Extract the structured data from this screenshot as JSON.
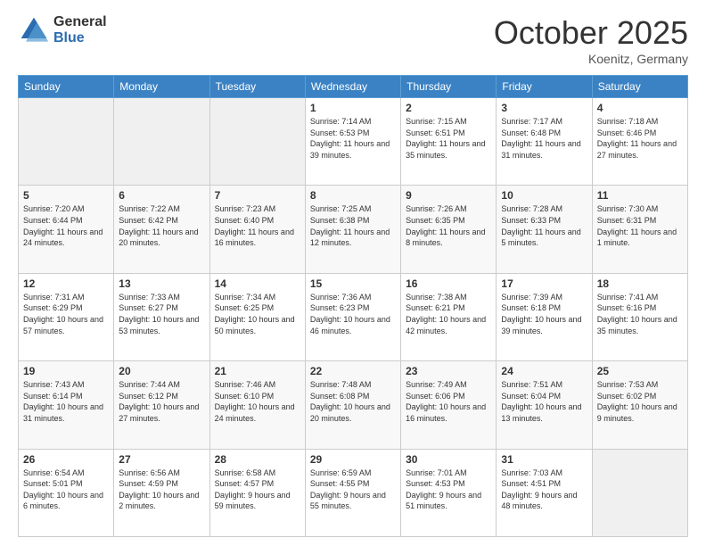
{
  "header": {
    "logo_general": "General",
    "logo_blue": "Blue",
    "month_title": "October 2025",
    "subtitle": "Koenitz, Germany"
  },
  "days_of_week": [
    "Sunday",
    "Monday",
    "Tuesday",
    "Wednesday",
    "Thursday",
    "Friday",
    "Saturday"
  ],
  "weeks": [
    [
      {
        "day": "",
        "info": ""
      },
      {
        "day": "",
        "info": ""
      },
      {
        "day": "",
        "info": ""
      },
      {
        "day": "1",
        "info": "Sunrise: 7:14 AM\nSunset: 6:53 PM\nDaylight: 11 hours and 39 minutes."
      },
      {
        "day": "2",
        "info": "Sunrise: 7:15 AM\nSunset: 6:51 PM\nDaylight: 11 hours and 35 minutes."
      },
      {
        "day": "3",
        "info": "Sunrise: 7:17 AM\nSunset: 6:48 PM\nDaylight: 11 hours and 31 minutes."
      },
      {
        "day": "4",
        "info": "Sunrise: 7:18 AM\nSunset: 6:46 PM\nDaylight: 11 hours and 27 minutes."
      }
    ],
    [
      {
        "day": "5",
        "info": "Sunrise: 7:20 AM\nSunset: 6:44 PM\nDaylight: 11 hours and 24 minutes."
      },
      {
        "day": "6",
        "info": "Sunrise: 7:22 AM\nSunset: 6:42 PM\nDaylight: 11 hours and 20 minutes."
      },
      {
        "day": "7",
        "info": "Sunrise: 7:23 AM\nSunset: 6:40 PM\nDaylight: 11 hours and 16 minutes."
      },
      {
        "day": "8",
        "info": "Sunrise: 7:25 AM\nSunset: 6:38 PM\nDaylight: 11 hours and 12 minutes."
      },
      {
        "day": "9",
        "info": "Sunrise: 7:26 AM\nSunset: 6:35 PM\nDaylight: 11 hours and 8 minutes."
      },
      {
        "day": "10",
        "info": "Sunrise: 7:28 AM\nSunset: 6:33 PM\nDaylight: 11 hours and 5 minutes."
      },
      {
        "day": "11",
        "info": "Sunrise: 7:30 AM\nSunset: 6:31 PM\nDaylight: 11 hours and 1 minute."
      }
    ],
    [
      {
        "day": "12",
        "info": "Sunrise: 7:31 AM\nSunset: 6:29 PM\nDaylight: 10 hours and 57 minutes."
      },
      {
        "day": "13",
        "info": "Sunrise: 7:33 AM\nSunset: 6:27 PM\nDaylight: 10 hours and 53 minutes."
      },
      {
        "day": "14",
        "info": "Sunrise: 7:34 AM\nSunset: 6:25 PM\nDaylight: 10 hours and 50 minutes."
      },
      {
        "day": "15",
        "info": "Sunrise: 7:36 AM\nSunset: 6:23 PM\nDaylight: 10 hours and 46 minutes."
      },
      {
        "day": "16",
        "info": "Sunrise: 7:38 AM\nSunset: 6:21 PM\nDaylight: 10 hours and 42 minutes."
      },
      {
        "day": "17",
        "info": "Sunrise: 7:39 AM\nSunset: 6:18 PM\nDaylight: 10 hours and 39 minutes."
      },
      {
        "day": "18",
        "info": "Sunrise: 7:41 AM\nSunset: 6:16 PM\nDaylight: 10 hours and 35 minutes."
      }
    ],
    [
      {
        "day": "19",
        "info": "Sunrise: 7:43 AM\nSunset: 6:14 PM\nDaylight: 10 hours and 31 minutes."
      },
      {
        "day": "20",
        "info": "Sunrise: 7:44 AM\nSunset: 6:12 PM\nDaylight: 10 hours and 27 minutes."
      },
      {
        "day": "21",
        "info": "Sunrise: 7:46 AM\nSunset: 6:10 PM\nDaylight: 10 hours and 24 minutes."
      },
      {
        "day": "22",
        "info": "Sunrise: 7:48 AM\nSunset: 6:08 PM\nDaylight: 10 hours and 20 minutes."
      },
      {
        "day": "23",
        "info": "Sunrise: 7:49 AM\nSunset: 6:06 PM\nDaylight: 10 hours and 16 minutes."
      },
      {
        "day": "24",
        "info": "Sunrise: 7:51 AM\nSunset: 6:04 PM\nDaylight: 10 hours and 13 minutes."
      },
      {
        "day": "25",
        "info": "Sunrise: 7:53 AM\nSunset: 6:02 PM\nDaylight: 10 hours and 9 minutes."
      }
    ],
    [
      {
        "day": "26",
        "info": "Sunrise: 6:54 AM\nSunset: 5:01 PM\nDaylight: 10 hours and 6 minutes."
      },
      {
        "day": "27",
        "info": "Sunrise: 6:56 AM\nSunset: 4:59 PM\nDaylight: 10 hours and 2 minutes."
      },
      {
        "day": "28",
        "info": "Sunrise: 6:58 AM\nSunset: 4:57 PM\nDaylight: 9 hours and 59 minutes."
      },
      {
        "day": "29",
        "info": "Sunrise: 6:59 AM\nSunset: 4:55 PM\nDaylight: 9 hours and 55 minutes."
      },
      {
        "day": "30",
        "info": "Sunrise: 7:01 AM\nSunset: 4:53 PM\nDaylight: 9 hours and 51 minutes."
      },
      {
        "day": "31",
        "info": "Sunrise: 7:03 AM\nSunset: 4:51 PM\nDaylight: 9 hours and 48 minutes."
      },
      {
        "day": "",
        "info": ""
      }
    ]
  ]
}
